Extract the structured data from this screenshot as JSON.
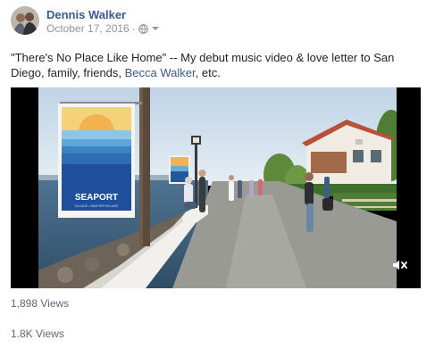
{
  "post": {
    "author": "Dennis Walker",
    "date": "October 17, 2016",
    "separator": "·",
    "icons": {
      "privacy": "globe-icon",
      "options": "chevron-down-icon",
      "avatar": "profile-photo"
    },
    "caption": {
      "text_before": "\"There's No Place Like Home\" -- My debut music video & love letter to San Diego, family, friends, ",
      "mention": "Becca Walker",
      "text_after": ", etc."
    }
  },
  "video": {
    "banner_title": "SEAPORT",
    "banner_subtitle": "VILLAGE • SEAPORTVILLAGE",
    "mute_icon": "volume-muted-icon"
  },
  "stats": {
    "views_primary": "1,898 Views",
    "views_secondary": "1.8K Views"
  }
}
